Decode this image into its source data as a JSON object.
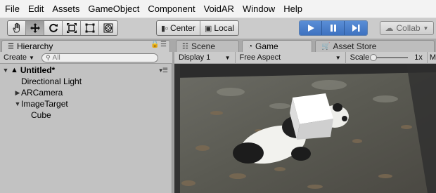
{
  "menubar": {
    "items": [
      "File",
      "Edit",
      "Assets",
      "GameObject",
      "Component",
      "VoidAR",
      "Window",
      "Help"
    ]
  },
  "toolbar": {
    "tools": [
      "hand-tool",
      "move-tool",
      "rotate-tool",
      "scale-tool",
      "rect-tool",
      "transform-tool"
    ],
    "active_tool": "move-tool",
    "pivot_label": "Center",
    "space_label": "Local",
    "playback": [
      "play",
      "pause",
      "step"
    ],
    "collab_label": "Collab",
    "accent_color": "#3e72c0"
  },
  "tabs": {
    "hierarchy": "Hierarchy",
    "scene": "Scene",
    "game": "Game",
    "asset_store": "Asset Store"
  },
  "hierarchy": {
    "create_label": "Create",
    "search_placeholder": "All",
    "scene_name": "Untitled*",
    "items": [
      {
        "label": "Directional Light",
        "depth": 1,
        "expander": ""
      },
      {
        "label": "ARCamera",
        "depth": 1,
        "expander": "▶"
      },
      {
        "label": "ImageTarget",
        "depth": 1,
        "expander": "▼"
      },
      {
        "label": "Cube",
        "depth": 2,
        "expander": ""
      }
    ]
  },
  "game": {
    "display_label": "Display 1",
    "aspect_label": "Free Aspect",
    "scale_label": "Scale",
    "scale_value": "1x",
    "extra_label": "M"
  }
}
